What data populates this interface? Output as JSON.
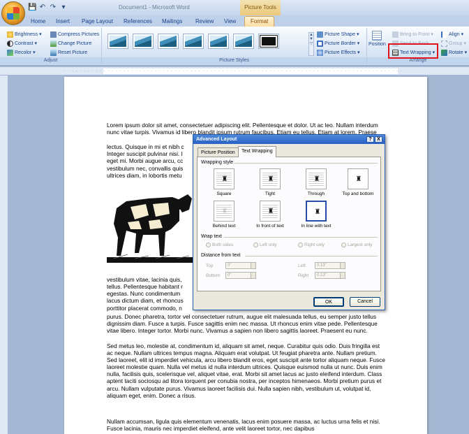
{
  "window": {
    "title": "Document1 - Microsoft Word",
    "contextual_tab_group": "Picture Tools"
  },
  "tabs": [
    "Home",
    "Insert",
    "Page Layout",
    "References",
    "Mailings",
    "Review",
    "View",
    "Format"
  ],
  "active_tab": "Format",
  "ribbon": {
    "adjust": {
      "label": "Adjust",
      "brightness": "Brightness",
      "contrast": "Contrast",
      "recolor": "Recolor",
      "compress": "Compress Pictures",
      "change": "Change Picture",
      "reset": "Reset Picture"
    },
    "picture_styles": {
      "label": "Picture Styles",
      "shape": "Picture Shape",
      "border": "Picture Border",
      "effects": "Picture Effects"
    },
    "arrange": {
      "label": "Arrange",
      "position": "Position",
      "bring_to_front": "Bring to Front",
      "send_to_back": "Send to Back",
      "text_wrapping": "Text Wrapping",
      "align": "Align",
      "group": "Group",
      "rotate": "Rotate"
    }
  },
  "document": {
    "para1": "Lorem ipsum dolor sit amet, consectetuer adipiscing elit. Pellentesque et dolor. Ut ac leo. Nullam interdum nunc vitae turpis. Vivamus id libero blandit ipsum rutrum faucibus. Etiam eu tellus. Etiam at lorem. Praese",
    "para1b": "lectus. Quisque in mi et nibh c",
    "para1c": "Integer suscipit pulvinar nisi. I",
    "para1d": "eget mi. Morbi augue arcu, cc",
    "para1e": "vestibulum nec, convallis quis",
    "para1f": "ultrices diam, in lobortis metu",
    "para2a": "vestibulum vitae, lacinia quis,",
    "para2b": "tellus. Pellentesque habitant r",
    "para2c": "egestas. Nunc condimentum",
    "para2d": "lacus dictum diam, et rhoncus",
    "para2e": "porttitor placerat commodo, n",
    "para2f": "purus. Donec pharetra, tortor vel consectetuer rutrum, augue elit malesuada tellus, eu semper justo tellus dignissim diam. Fusce a turpis. Fusce sagittis enim nec massa. Ut rhoncus enim vitae pede. Pellentesque vitae libero. Integer tortor. Morbi nunc. Vivamus a sapien non libero sagittis laoreet. Praesent eu nunc.",
    "para3": "Sed metus leo, molestie at, condimentum id, aliquam sit amet, neque. Curabitur quis odio. Duis fringilla est ac neque. Nullam ultrices tempus magna. Aliquam erat volutpat. Ut feugiat pharetra ante. Nullam pretium. Sed laoreet, elit id imperdiet vehicula, arcu libero blandit eros, eget suscipit ante tortor aliquam neque. Fusce laoreet molestie quam. Nulla vel metus id nulla interdum ultrices. Quisque euismod nulla ut nunc. Duis enim nulla, facilisis quis, scelerisque vel, aliquet vitae, erat. Morbi sit amet lacus ac justo eleifend interdum. Class aptent taciti sociosqu ad litora torquent per conubia nostra, per inceptos himenaeos. Morbi pretium purus et arcu. Nullam vulputate purus. Vivamus laoreet facilisis dui. Nulla sapien nibh, vestibulum ut, volutpat id, aliquam eget, enim. Donec a risus.",
    "para4": "Nullam accumsan, ligula quis elementum venenatis, lacus enim posuere massa, ac luctus urna felis et nisi. Fusce lacinia, mauris nec imperdiet eleifend, ante velit laoreet tortor, nec dapibus"
  },
  "dialog": {
    "title": "Advanced Layout",
    "help": "?",
    "close": "X",
    "tabs": [
      "Picture Position",
      "Text Wrapping"
    ],
    "active_tab": "Text Wrapping",
    "wrapping_style_label": "Wrapping style",
    "wrap_options": [
      "Square",
      "Tight",
      "Through",
      "Top and bottom",
      "Behind text",
      "In front of text",
      "In line with text"
    ],
    "selected_option": "In line with text",
    "wrap_text_label": "Wrap text",
    "wrap_text_options": [
      "Both sides",
      "Left only",
      "Right only",
      "Largest only"
    ],
    "distance_label": "Distance from text",
    "top_label": "Top",
    "bottom_label": "Bottom",
    "left_label": "Left",
    "right_label": "Right",
    "top_value": "0\"",
    "bottom_value": "0\"",
    "left_value": "0.13\"",
    "right_value": "0.13\"",
    "ok": "OK",
    "cancel": "Cancel"
  }
}
